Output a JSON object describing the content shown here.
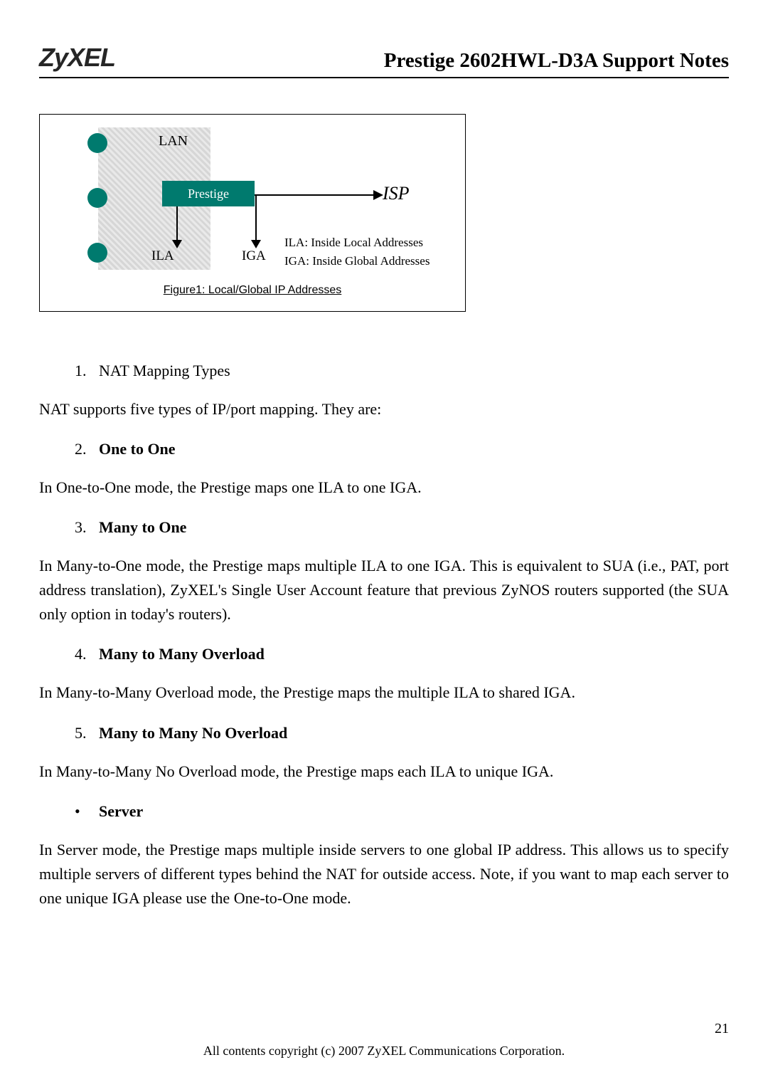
{
  "header": {
    "logo": "ZyXEL",
    "title": "Prestige 2602HWL-D3A Support Notes"
  },
  "figure": {
    "lan": "LAN",
    "prestige": "Prestige",
    "isp": "ISP",
    "ila": "ILA",
    "iga": "IGA",
    "desc_ila": "ILA: Inside Local Addresses",
    "desc_iga": "IGA: Inside Global Addresses",
    "caption": "Figure1: Local/Global IP Addresses"
  },
  "items": [
    {
      "num": "1.",
      "label": "NAT Mapping Types",
      "bold": false
    }
  ],
  "p1": "NAT supports five types of IP/port mapping. They are:",
  "item2": {
    "num": "2.",
    "label": "One to One"
  },
  "p2": "In One-to-One mode, the Prestige maps one ILA to one IGA.",
  "item3": {
    "num": "3.",
    "label": "Many to One"
  },
  "p3": "In Many-to-One mode, the Prestige maps multiple ILA to one IGA. This is equivalent to SUA (i.e., PAT, port address translation), ZyXEL's Single User Account feature that previous ZyNOS routers supported (the SUA only option in today's routers).",
  "item4": {
    "num": "4.",
    "label": "Many to Many Overload"
  },
  "p4": "In Many-to-Many Overload mode, the Prestige maps the multiple ILA to shared IGA.",
  "item5": {
    "num": "5.",
    "label": "Many to Many No Overload"
  },
  "p5": "In Many-to-Many No Overload mode, the Prestige maps each ILA to unique IGA.",
  "bullet": {
    "label": "Server"
  },
  "p6": "In Server mode, the Prestige maps multiple inside servers to one global IP address. This allows us to specify multiple servers of different types behind the NAT for outside access. Note, if you want to map each server to one unique IGA please use the One-to-One mode.",
  "page_number": "21",
  "footer": "All contents copyright (c) 2007 ZyXEL Communications Corporation."
}
